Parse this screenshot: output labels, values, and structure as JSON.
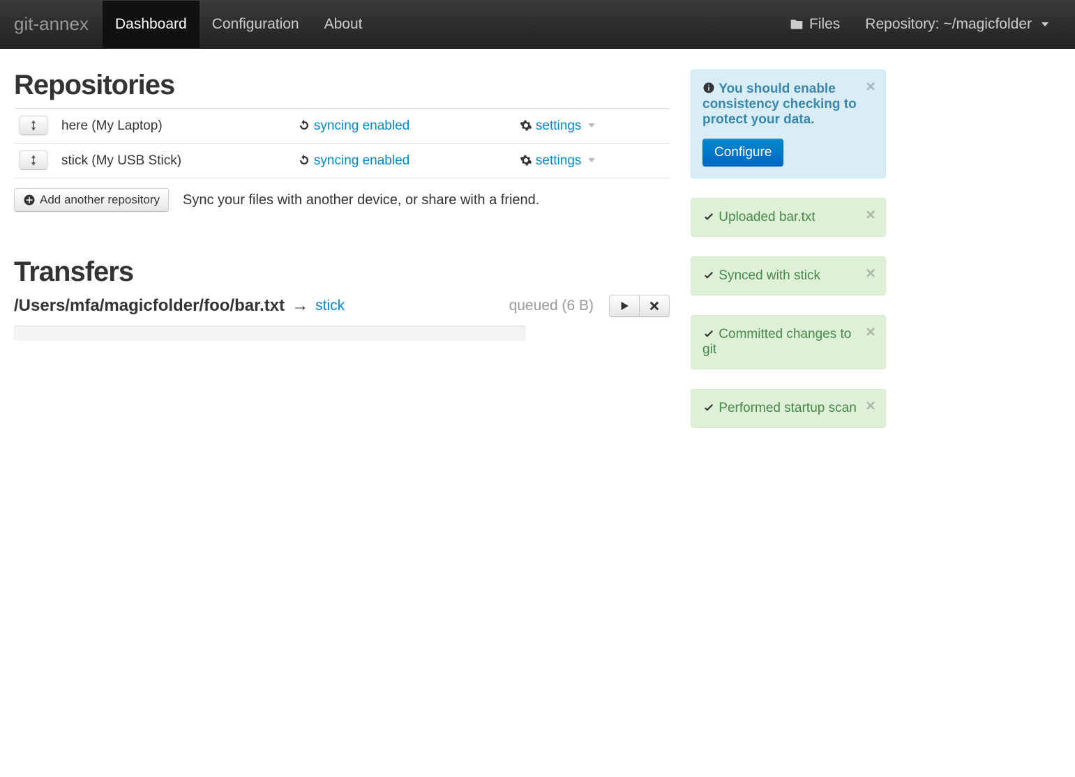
{
  "navbar": {
    "brand": "git-annex",
    "items": [
      {
        "label": "Dashboard",
        "active": true
      },
      {
        "label": "Configuration",
        "active": false
      },
      {
        "label": "About",
        "active": false
      }
    ],
    "files_label": "Files",
    "repo_label": "Repository: ~/magicfolder"
  },
  "repos": {
    "heading": "Repositories",
    "rows": [
      {
        "name": "here (My Laptop)",
        "sync": "syncing enabled",
        "settings": "settings"
      },
      {
        "name": "stick (My USB Stick)",
        "sync": "syncing enabled",
        "settings": "settings"
      }
    ],
    "add_button": "Add another repository",
    "add_hint": "Sync your files with another device, or share with a friend."
  },
  "transfers": {
    "heading": "Transfers",
    "path": "/Users/mfa/magicfolder/foo/bar.txt",
    "arrow": "→",
    "dest": "stick",
    "status": "queued (6 B)"
  },
  "alerts": {
    "info": {
      "text": "You should enable consistency checking to protect your data.",
      "button": "Configure"
    },
    "success": [
      "Uploaded bar.txt",
      "Synced with stick",
      "Committed changes to git",
      "Performed startup scan"
    ]
  }
}
